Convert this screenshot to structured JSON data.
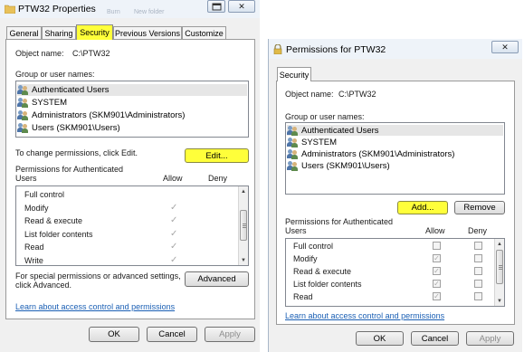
{
  "props_window": {
    "title": "PTW32 Properties",
    "title_controls": [
      "help-icon",
      "close-icon"
    ],
    "ghost_text": [
      "Burn",
      "New folder"
    ],
    "tabs": [
      "General",
      "Sharing",
      "Security",
      "Previous Versions",
      "Customize"
    ],
    "active_tab": "Security",
    "object_label": "Object name:",
    "object_value": "C:\\PTW32",
    "group_label": "Group or user names:",
    "users": [
      "Authenticated Users",
      "SYSTEM",
      "Administrators (SKM901\\Administrators)",
      "Users (SKM901\\Users)"
    ],
    "change_text": "To change permissions, click Edit.",
    "edit_label": "Edit...",
    "perm_label_line1": "Permissions for Authenticated",
    "perm_label_line2": "Users",
    "allow_header": "Allow",
    "deny_header": "Deny",
    "permissions": [
      "Full control",
      "Modify",
      "Read & execute",
      "List folder contents",
      "Read",
      "Write"
    ],
    "special_line1": "For special permissions or advanced settings,",
    "special_line2": "click Advanced.",
    "advanced_label": "Advanced",
    "learn_link": "Learn about access control and permissions",
    "ok_label": "OK",
    "cancel_label": "Cancel",
    "apply_label": "Apply"
  },
  "perm_window": {
    "title": "Permissions for PTW32",
    "title_controls": [
      "close-icon"
    ],
    "tab": "Security",
    "object_label": "Object name:",
    "object_value": "C:\\PTW32",
    "group_label": "Group or user names:",
    "users": [
      "Authenticated Users",
      "SYSTEM",
      "Administrators (SKM901\\Administrators)",
      "Users (SKM901\\Users)"
    ],
    "add_label": "Add...",
    "remove_label": "Remove",
    "perm_label_line1": "Permissions for Authenticated",
    "perm_label_line2": "Users",
    "allow_header": "Allow",
    "deny_header": "Deny",
    "permissions": [
      "Full control",
      "Modify",
      "Read & execute",
      "List folder contents",
      "Read"
    ],
    "learn_link": "Learn about access control and permissions",
    "ok_label": "OK",
    "cancel_label": "Cancel",
    "apply_label": "Apply"
  },
  "colors": {
    "highlight": "#ffff3a",
    "link": "#1a5fb4",
    "title_bar": "#eef3f9"
  }
}
